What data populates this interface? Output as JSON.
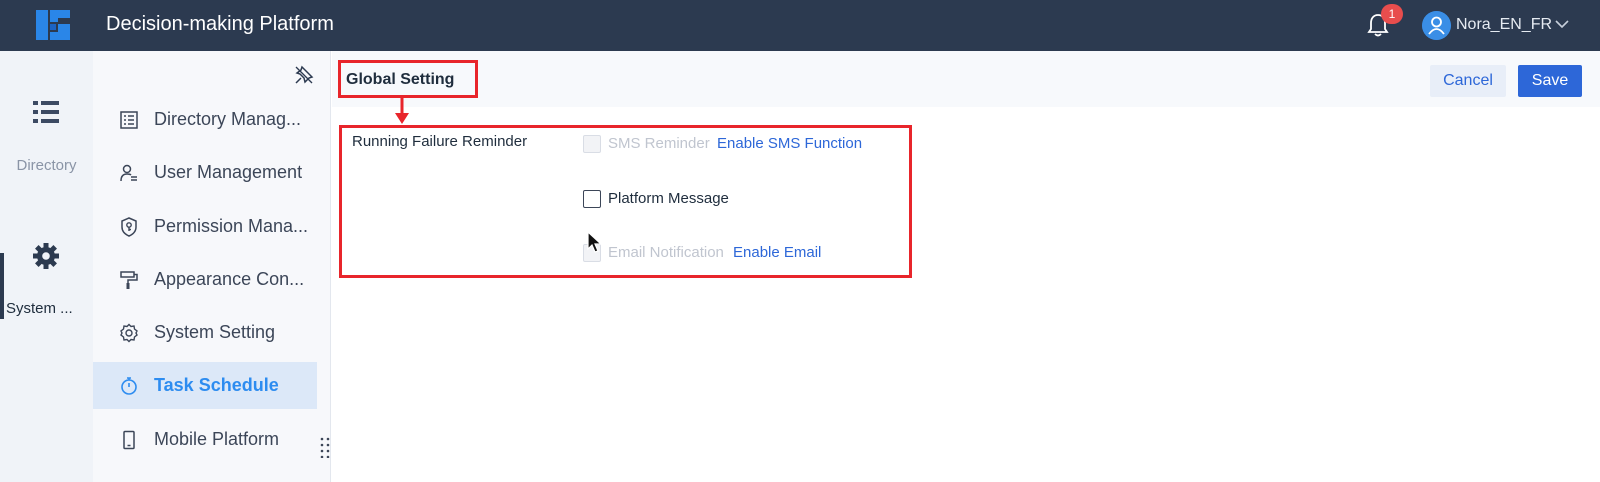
{
  "header": {
    "app_title": "Decision-making Platform",
    "notification_count": "1",
    "user_name": "Nora_EN_FR",
    "brand_color": "#2c3a50"
  },
  "rail": {
    "items": [
      {
        "label": "Directory",
        "icon": "list-icon"
      },
      {
        "label": "System ...",
        "icon": "gear-icon",
        "active": true
      }
    ]
  },
  "menu": {
    "items": [
      {
        "label": "Directory Manag...",
        "icon": "document-list-icon"
      },
      {
        "label": "User Management",
        "icon": "user-icon"
      },
      {
        "label": "Permission Mana...",
        "icon": "shield-key-icon"
      },
      {
        "label": "Appearance Con...",
        "icon": "paint-roller-icon"
      },
      {
        "label": "System Setting",
        "icon": "gear-outline-icon"
      },
      {
        "label": "Task Schedule",
        "icon": "stopwatch-icon",
        "active": true
      },
      {
        "label": "Mobile Platform",
        "icon": "mobile-icon"
      }
    ]
  },
  "content": {
    "page_title": "Global Setting",
    "cancel_label": "Cancel",
    "save_label": "Save",
    "section_label": "Running Failure Reminder",
    "options": [
      {
        "label": "SMS Reminder",
        "checked": false,
        "disabled": true,
        "link": "Enable SMS Function"
      },
      {
        "label": "Platform Message",
        "checked": false,
        "disabled": false,
        "link": ""
      },
      {
        "label": "Email Notification",
        "checked": false,
        "disabled": true,
        "link": "Enable Email"
      }
    ]
  },
  "colors": {
    "accent": "#2d67d8",
    "highlight_box": "#e8252b",
    "active_menu_bg": "#dce8f8"
  }
}
